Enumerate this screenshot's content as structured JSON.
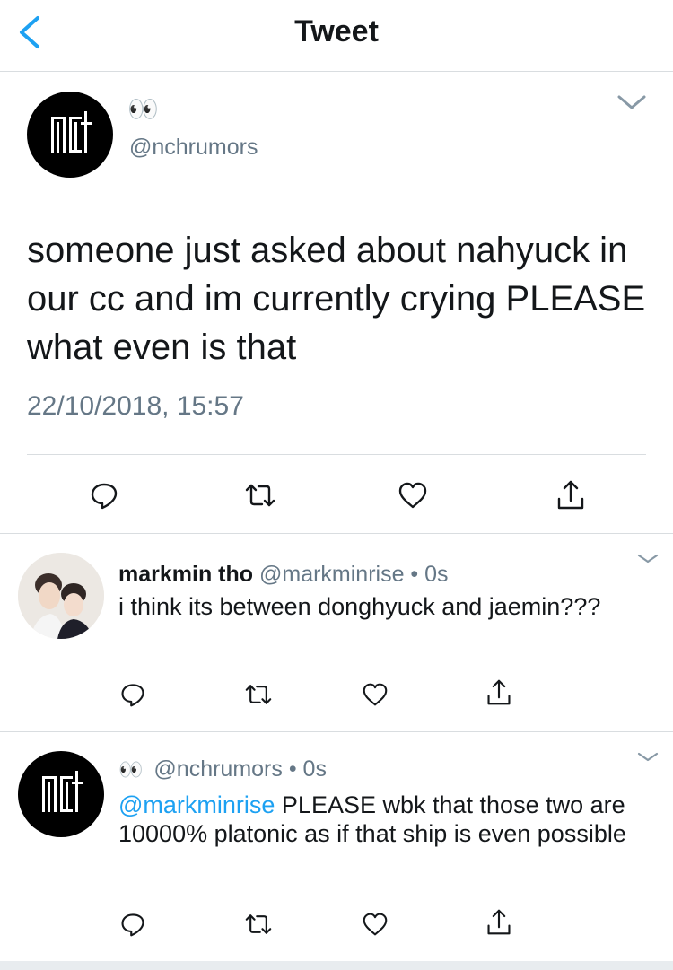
{
  "header": {
    "title": "Tweet"
  },
  "main_tweet": {
    "display_name": "👀",
    "handle": "@nchrumors",
    "text": "someone just asked about nahyuck in our cc and im currently crying PLEASE what even is that",
    "timestamp": "22/10/2018, 15:57",
    "avatar_logo": "NCT"
  },
  "replies": [
    {
      "display_name": "markmin tho",
      "handle": "@markminrise",
      "time": "0s",
      "text": "i think its between donghyuck and jaemin???"
    },
    {
      "display_name": "👀",
      "handle": "@nchrumors",
      "time": "0s",
      "mention": "@markminrise",
      "text": " PLEASE wbk that those two are 10000% platonic as if that ship is even possible"
    }
  ],
  "meta_separator": " • ",
  "icons": [
    "back-chevron-icon",
    "caret-down-icon",
    "reply-icon",
    "retweet-icon",
    "like-icon",
    "share-icon"
  ],
  "colors": {
    "link": "#1da1f2",
    "muted": "#657786",
    "text": "#14171a",
    "divider": "#d9dde0"
  }
}
